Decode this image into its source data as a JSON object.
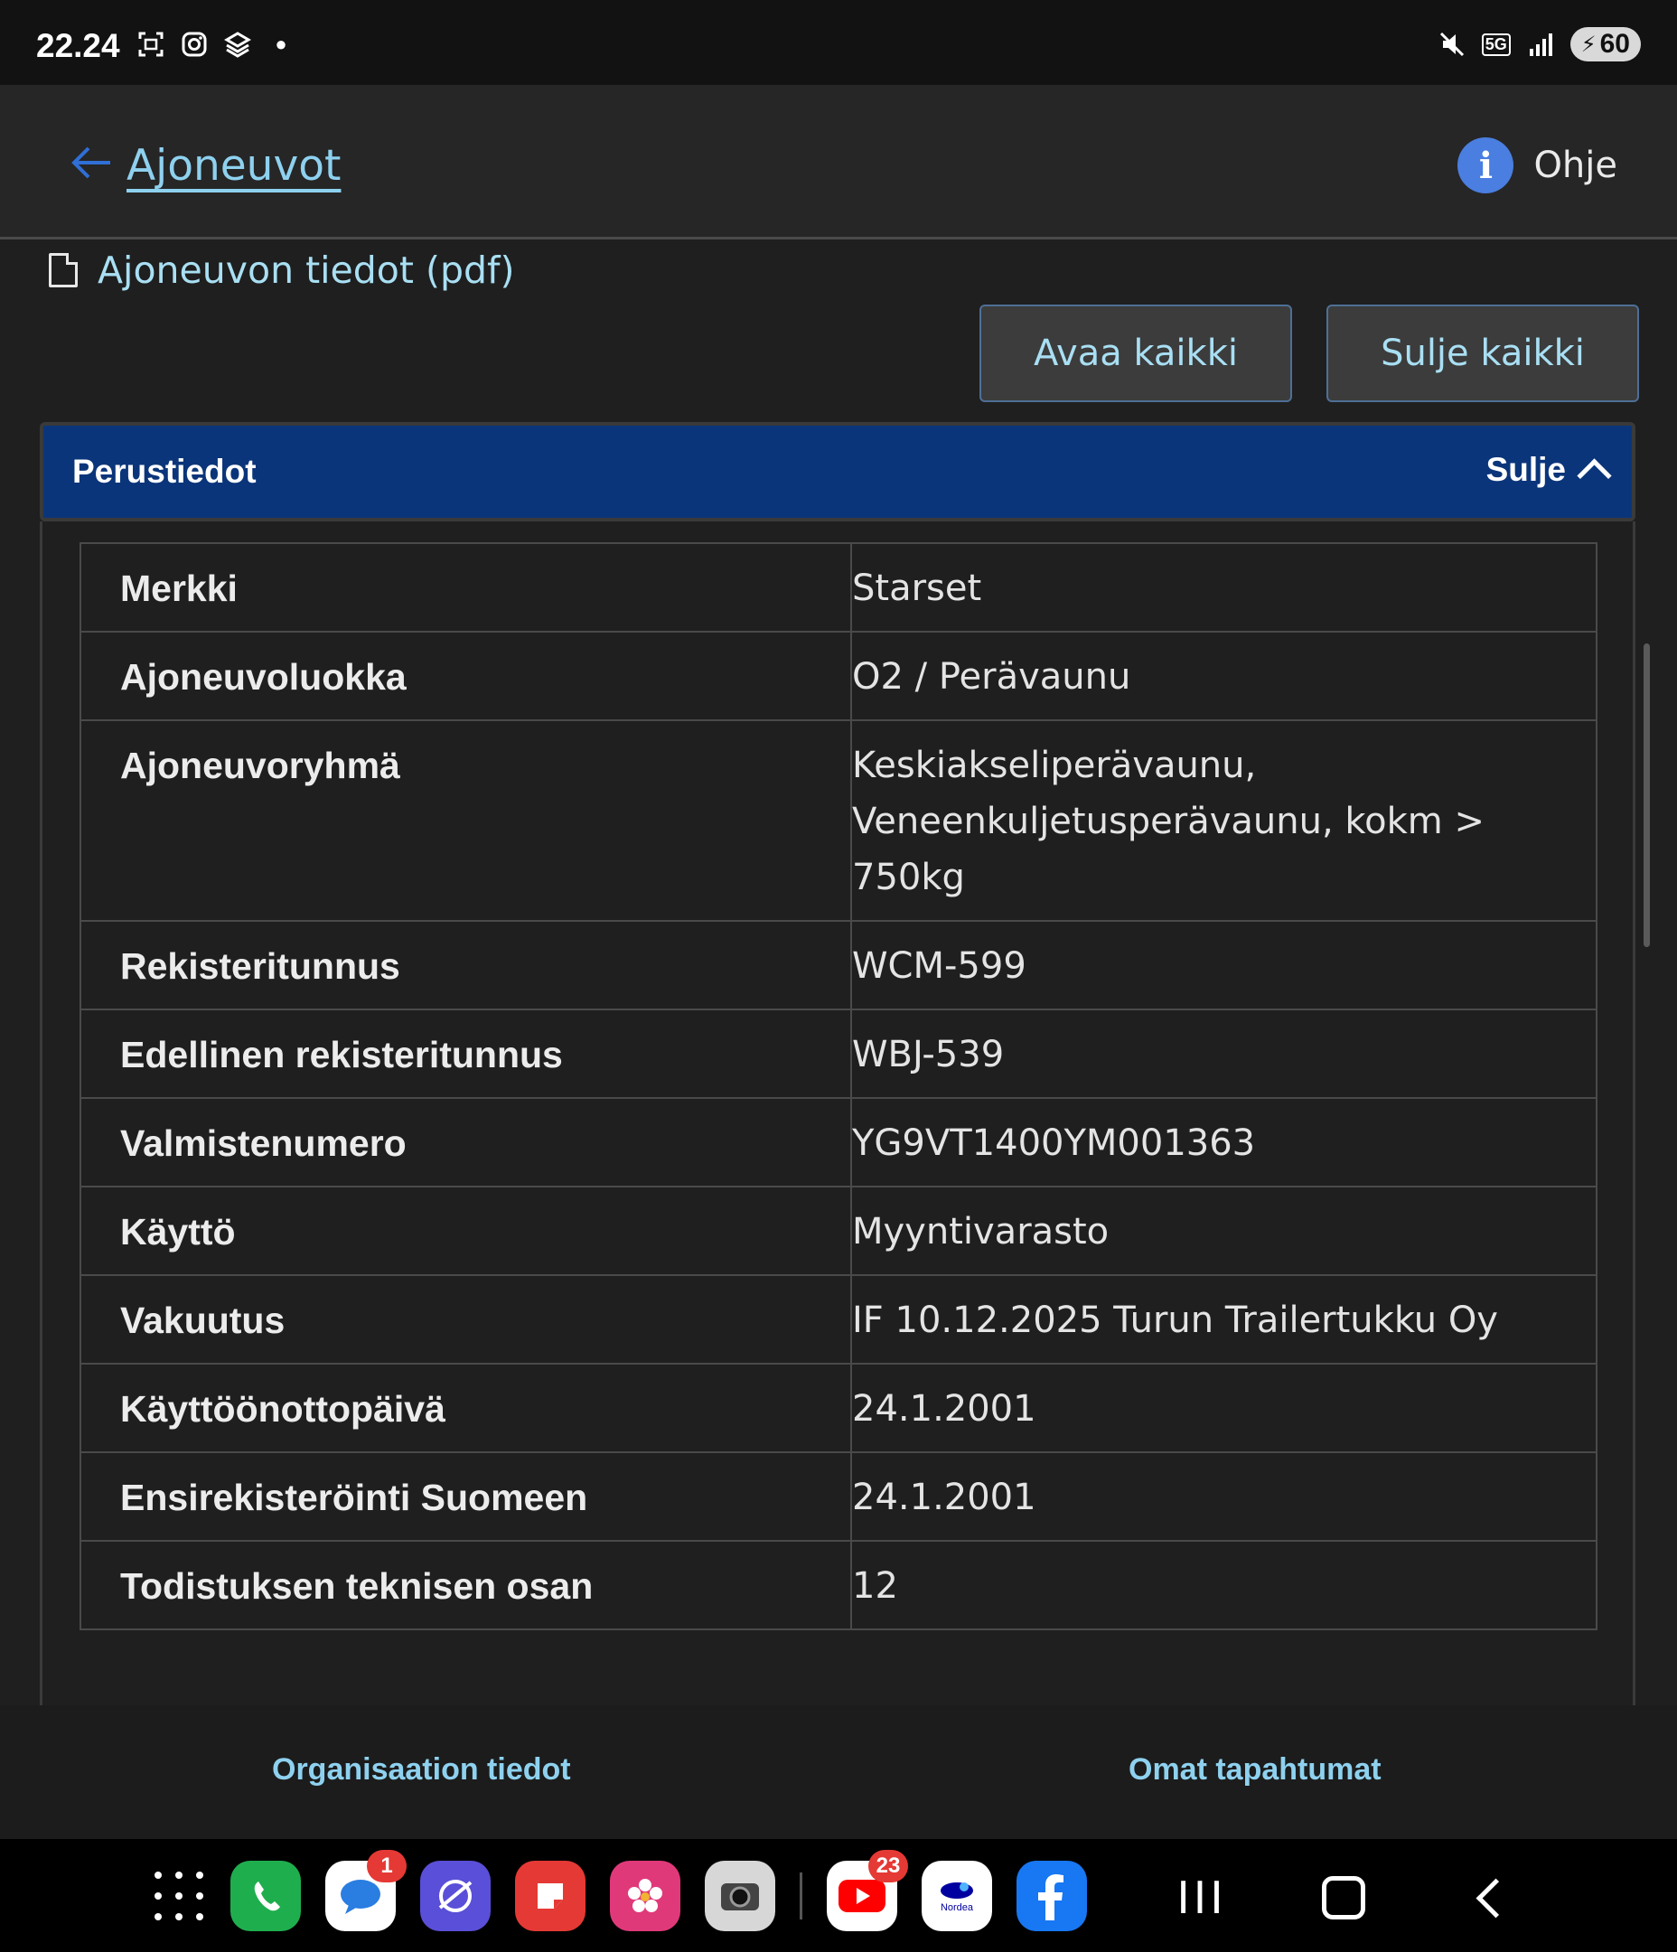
{
  "status_bar": {
    "time": "22.24",
    "left_icons": [
      "screenshot-icon",
      "instagram-icon",
      "stack-icon",
      "dot-icon"
    ],
    "right_icons": [
      "mute-icon",
      "5g-icon",
      "signal-icon"
    ],
    "network": "5G",
    "battery": "60"
  },
  "header": {
    "back_label": "Ajoneuvot",
    "help_label": "Ohje",
    "help_icon_text": "i"
  },
  "actions": {
    "pdf_label": "Ajoneuvon tiedot (pdf)",
    "open_all": "Avaa kaikki",
    "close_all": "Sulje kaikki"
  },
  "section": {
    "title": "Perustiedot",
    "toggle_label": "Sulje",
    "rows": [
      {
        "label": "Merkki",
        "value": "Starset"
      },
      {
        "label": "Ajoneuvoluokka",
        "value": "O2 / Perävaunu"
      },
      {
        "label": "Ajoneuvoryhmä",
        "value": "Keskiakseliperävaunu, Veneenkuljetusperävaunu, kokm > 750kg"
      },
      {
        "label": "Rekisteritunnus",
        "value": "WCM-599"
      },
      {
        "label": "Edellinen rekisteritunnus",
        "value": "WBJ-539"
      },
      {
        "label": "Valmistenumero",
        "value": "YG9VT1400YM001363"
      },
      {
        "label": "Käyttö",
        "value": "Myyntivarasto"
      },
      {
        "label": "Vakuutus",
        "value": "IF 10.12.2025 Turun Trailertukku Oy"
      },
      {
        "label": "Käyttöönottopäivä",
        "value": "24.1.2001"
      },
      {
        "label": "Ensirekisteröinti Suomeen",
        "value": "24.1.2001"
      },
      {
        "label": "Todistuksen teknisen osan",
        "value": "12"
      }
    ]
  },
  "footer": {
    "link1": "Organisaation tiedot",
    "link2": "Omat tapahtumat"
  },
  "nav_bar": {
    "apps": [
      {
        "name": "phone",
        "color": "#1fae4e",
        "badge": ""
      },
      {
        "name": "messages",
        "color": "#ffffff",
        "badge": "1"
      },
      {
        "name": "internet",
        "color": "#5a4fd8",
        "badge": ""
      },
      {
        "name": "notes",
        "color": "#e53935",
        "badge": ""
      },
      {
        "name": "gallery",
        "color": "#e0397a",
        "badge": ""
      },
      {
        "name": "camera",
        "color": "#d7d7d7",
        "badge": ""
      },
      {
        "name": "youtube",
        "color": "#ffffff",
        "badge": "23"
      },
      {
        "name": "nordea",
        "color": "#ffffff",
        "badge": ""
      },
      {
        "name": "facebook",
        "color": "#1877f2",
        "badge": ""
      }
    ],
    "nordea_text": "Nordea",
    "recents_glyph": "III"
  }
}
